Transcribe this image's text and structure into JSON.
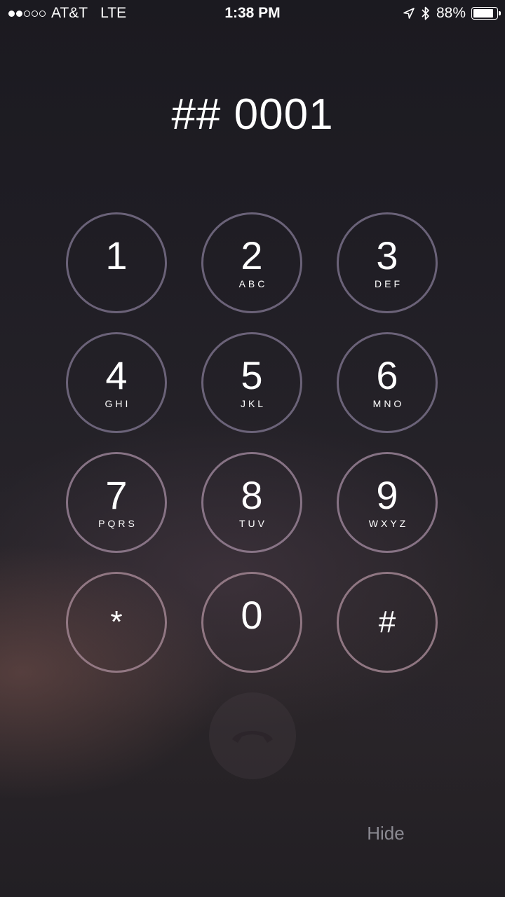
{
  "status_bar": {
    "signal_dots_filled": 2,
    "signal_dots_total": 5,
    "carrier": "AT&T",
    "network": "LTE",
    "time": "1:38 PM",
    "battery_percent_label": "88%",
    "battery_level": 0.88,
    "icons": [
      "location-arrow-icon",
      "bluetooth-icon",
      "battery-icon"
    ]
  },
  "dialer": {
    "display": "## 0001",
    "keys": [
      {
        "digit": "1",
        "letters": ""
      },
      {
        "digit": "2",
        "letters": "ABC"
      },
      {
        "digit": "3",
        "letters": "DEF"
      },
      {
        "digit": "4",
        "letters": "GHI"
      },
      {
        "digit": "5",
        "letters": "JKL"
      },
      {
        "digit": "6",
        "letters": "MNO"
      },
      {
        "digit": "7",
        "letters": "PQRS"
      },
      {
        "digit": "8",
        "letters": "TUV"
      },
      {
        "digit": "9",
        "letters": "WXYZ"
      },
      {
        "digit": "*",
        "letters": ""
      },
      {
        "digit": "0",
        "letters": ""
      },
      {
        "digit": "#",
        "letters": ""
      }
    ],
    "hide_label": "Hide"
  },
  "colors": {
    "text": "#ffffff",
    "key_ring": "#786e87",
    "hide_text": "#8b8a92"
  }
}
